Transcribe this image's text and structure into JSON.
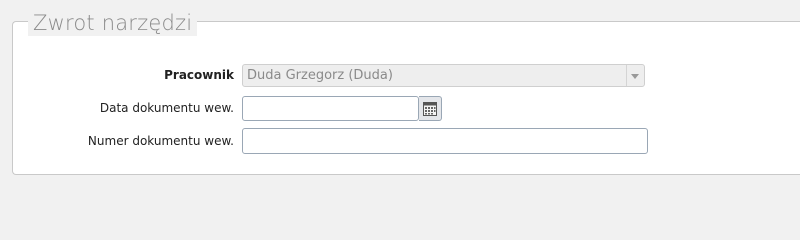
{
  "fieldset": {
    "legend": "Zwrot narzędzi"
  },
  "form": {
    "employee": {
      "label": "Pracownik",
      "value": "Duda Grzegorz (Duda)"
    },
    "doc_date": {
      "label": "Data dokumentu wew.",
      "value": "",
      "icon": "calendar-icon"
    },
    "doc_number": {
      "label": "Numer dokumentu wew.",
      "value": ""
    }
  }
}
